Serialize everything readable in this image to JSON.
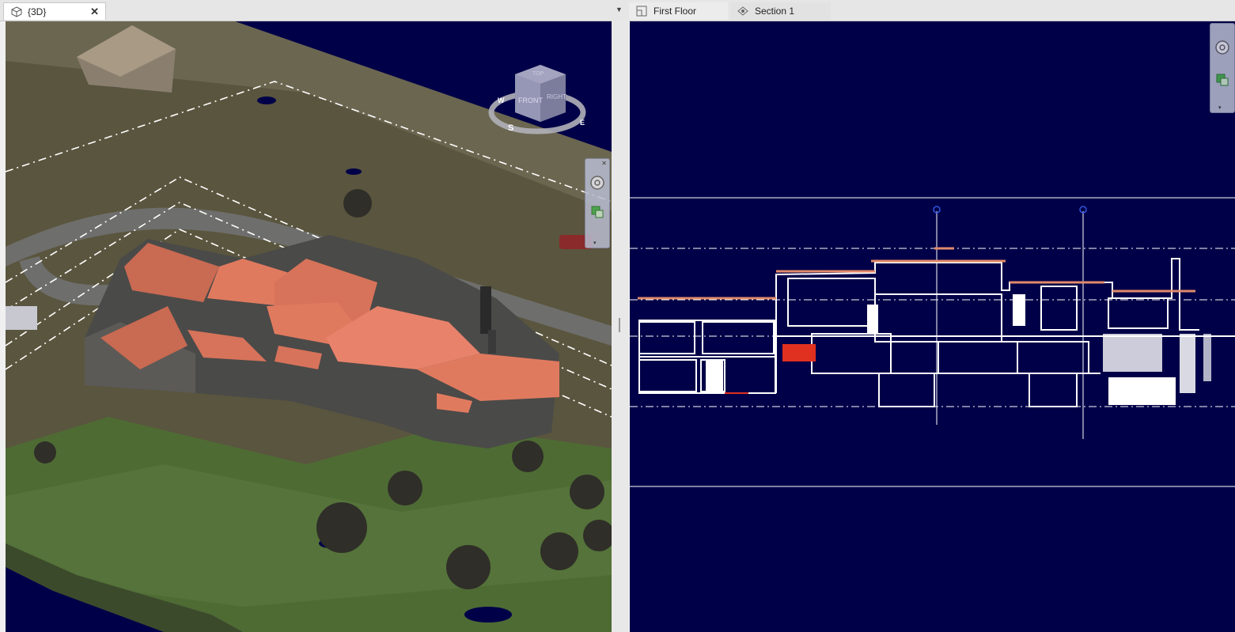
{
  "left_view": {
    "tab_label": "{3D}",
    "close_glyph": "✕"
  },
  "right_views": {
    "dropdown_glyph": "▼",
    "tabs": [
      {
        "label": "First Floor"
      },
      {
        "label": "Section 1"
      }
    ]
  },
  "viewcube": {
    "faces": {
      "front": "FRONT",
      "right": "RIGHT",
      "top": "TOP"
    },
    "compass": {
      "south": "S",
      "west": "W",
      "east": "E"
    }
  },
  "colors": {
    "view_background": "#000048",
    "roof": "#e07a5f",
    "lawn": "#4e6b34"
  },
  "icons": [
    "3d-view-icon",
    "close-icon",
    "floor-plan-icon",
    "section-icon",
    "zoom-icon",
    "steering-wheel-icon",
    "dropdown-arrow-icon"
  ]
}
